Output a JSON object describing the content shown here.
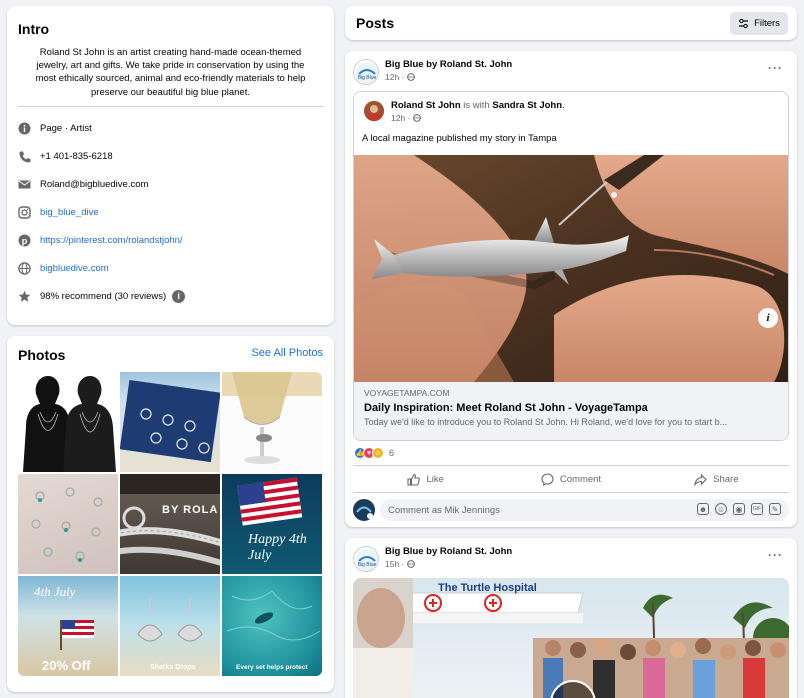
{
  "intro": {
    "title": "Intro",
    "bio": "Roland St John is an artist creating hand-made ocean-themed jewelry, art and gifts. We take pride in conservation by using the most ethically sourced, animal and eco-friendly materials to help preserve our beautiful big blue planet.",
    "details": [
      {
        "icon": "info-icon",
        "text": "Page · Artist",
        "link": false
      },
      {
        "icon": "phone-icon",
        "text": "+1 401-835-6218",
        "link": false
      },
      {
        "icon": "email-icon",
        "text": "Roland@bigbluedive.com",
        "link": false
      },
      {
        "icon": "instagram-icon",
        "text": "big_blue_dive",
        "link": true
      },
      {
        "icon": "pinterest-icon",
        "text": "https://pinterest.com/rolandstjohn/",
        "link": true
      },
      {
        "icon": "globe-icon",
        "text": "bigbluedive.com",
        "link": true
      },
      {
        "icon": "star-icon",
        "text": "98% recommend (30 reviews)",
        "link": false
      }
    ]
  },
  "photos": {
    "title": "Photos",
    "see_all": "See All Photos",
    "overlays": {
      "by_roland": "BY ROLA",
      "happy_4th": "Happy 4th July",
      "fourth_july": "4th July",
      "twenty_off": "20% Off",
      "sharks_drops": "Sharks Drops",
      "every_set": "Every set helps protect"
    }
  },
  "posts": {
    "title": "Posts",
    "filters_label": "Filters",
    "post1": {
      "author": "Big Blue by Roland St. John",
      "time": "12h ·",
      "shared": {
        "author": "Roland St John",
        "with_text": " is with ",
        "with_person": "Sandra St John",
        "period": ".",
        "time": "12h ·",
        "text": "A local magazine published my story in Tampa",
        "link_domain": "VOYAGETAMPA.COM",
        "link_title": "Daily Inspiration: Meet Roland St John - VoyageTampa",
        "link_desc": "Today we'd like to introduce you to Roland St John. Hi Roland, we'd love for you to start b..."
      },
      "reaction_count": "6",
      "actions": {
        "like": "Like",
        "comment": "Comment",
        "share": "Share"
      },
      "comment_placeholder": "Comment as Mik Jennings"
    },
    "post2": {
      "author": "Big Blue by Roland St. John",
      "time": "15h ·",
      "banner_text": "The Turtle Hospital"
    }
  },
  "colors": {
    "link": "#216fdb",
    "bg": "#f0f2f5",
    "like": "#1877f2",
    "love": "#f33e58",
    "haha": "#f7b125"
  }
}
